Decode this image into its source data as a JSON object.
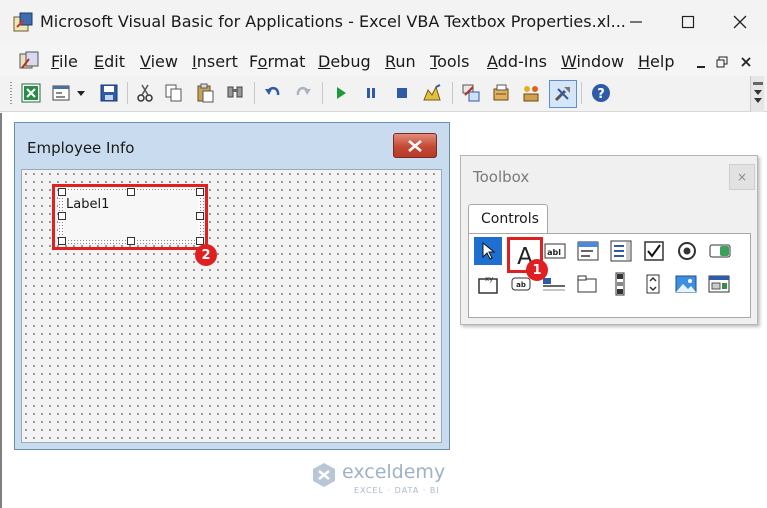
{
  "window": {
    "title": "Microsoft Visual Basic for Applications - Excel VBA Textbox Properties.xl...",
    "controls": {
      "minimize": "minimize-icon",
      "maximize": "maximize-icon",
      "close": "close-icon"
    }
  },
  "menu": {
    "items": [
      {
        "label": "File",
        "u": "F",
        "rest": "ile"
      },
      {
        "label": "Edit",
        "u": "E",
        "rest": "dit"
      },
      {
        "label": "View",
        "u": "V",
        "rest": "iew"
      },
      {
        "label": "Insert",
        "u": "I",
        "rest": "nsert"
      },
      {
        "label": "Format",
        "pre": "F",
        "u": "o",
        "rest": "rmat"
      },
      {
        "label": "Debug",
        "u": "D",
        "rest": "ebug"
      },
      {
        "label": "Run",
        "u": "R",
        "rest": "un"
      },
      {
        "label": "Tools",
        "u": "T",
        "rest": "ools"
      },
      {
        "label": "Add-Ins",
        "u": "A",
        "rest": "dd-Ins"
      },
      {
        "label": "Window",
        "u": "W",
        "rest": "indow"
      },
      {
        "label": "Help",
        "u": "H",
        "rest": "elp"
      }
    ]
  },
  "toolbar": {
    "icons": [
      "excel-icon",
      "insert-userform-icon",
      "dropdown-arrow-icon",
      "save-icon",
      "cut-icon",
      "copy-icon",
      "paste-icon",
      "find-icon",
      "undo-icon",
      "redo-icon",
      "run-icon",
      "break-icon",
      "reset-icon",
      "design-mode-icon",
      "project-explorer-icon",
      "properties-icon",
      "object-browser-icon",
      "toolbox-icon",
      "help-icon"
    ]
  },
  "userform": {
    "title": "Employee Info",
    "label_caption": "Label1"
  },
  "toolbox": {
    "title": "Toolbox",
    "close": "×",
    "tab": "Controls"
  },
  "annotations": {
    "badge1": "1",
    "badge2": "2"
  },
  "watermark": {
    "name": "exceldemy",
    "tagline": "EXCEL · DATA · BI"
  },
  "colors": {
    "accent_red": "#e02020",
    "form_blue": "#c9dcef",
    "selected_tool": "#1f6fd1"
  }
}
